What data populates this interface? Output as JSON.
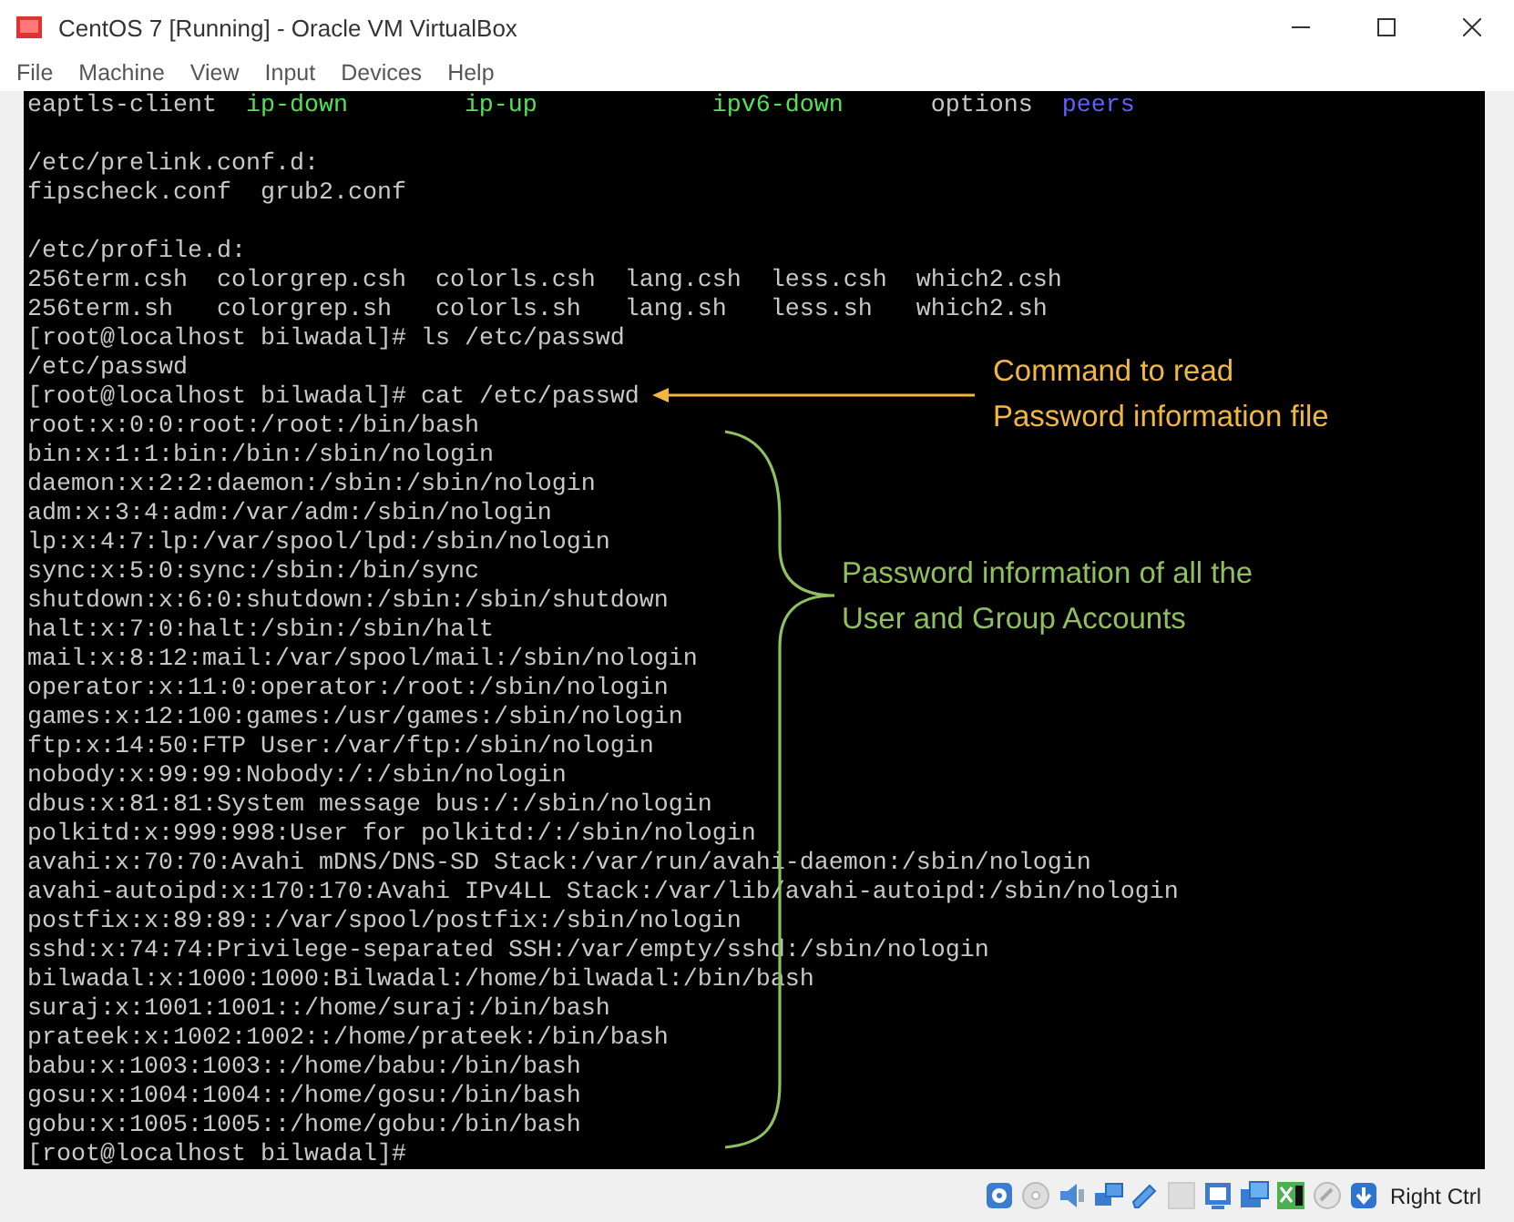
{
  "window": {
    "title": "CentOS 7 [Running] - Oracle VM VirtualBox"
  },
  "menu": [
    "File",
    "Machine",
    "View",
    "Input",
    "Devices",
    "Help"
  ],
  "terminal": {
    "lines": [
      {
        "kind": "columns",
        "segments": [
          {
            "text": "eaptls-client",
            "kind": "file"
          },
          {
            "text": "ip-down",
            "kind": "exec"
          },
          {
            "text": "ip-up",
            "kind": "exec"
          },
          {
            "text": "ipv6-down",
            "kind": "exec"
          },
          {
            "text": "options",
            "kind": "file"
          },
          {
            "text": "peers",
            "kind": "dir"
          }
        ]
      },
      {
        "kind": "blank"
      },
      {
        "kind": "text",
        "text": "/etc/prelink.conf.d:"
      },
      {
        "kind": "text",
        "text": "fipscheck.conf  grub2.conf"
      },
      {
        "kind": "blank"
      },
      {
        "kind": "text",
        "text": "/etc/profile.d:"
      },
      {
        "kind": "text",
        "text": "256term.csh  colorgrep.csh  colorls.csh  lang.csh  less.csh  which2.csh"
      },
      {
        "kind": "text",
        "text": "256term.sh   colorgrep.sh   colorls.sh   lang.sh   less.sh   which2.sh"
      },
      {
        "kind": "text",
        "text": "[root@localhost bilwadal]# ls /etc/passwd"
      },
      {
        "kind": "text",
        "text": "/etc/passwd"
      },
      {
        "kind": "text",
        "text": "[root@localhost bilwadal]# cat /etc/passwd"
      },
      {
        "kind": "text",
        "text": "root:x:0:0:root:/root:/bin/bash"
      },
      {
        "kind": "text",
        "text": "bin:x:1:1:bin:/bin:/sbin/nologin"
      },
      {
        "kind": "text",
        "text": "daemon:x:2:2:daemon:/sbin:/sbin/nologin"
      },
      {
        "kind": "text",
        "text": "adm:x:3:4:adm:/var/adm:/sbin/nologin"
      },
      {
        "kind": "text",
        "text": "lp:x:4:7:lp:/var/spool/lpd:/sbin/nologin"
      },
      {
        "kind": "text",
        "text": "sync:x:5:0:sync:/sbin:/bin/sync"
      },
      {
        "kind": "text",
        "text": "shutdown:x:6:0:shutdown:/sbin:/sbin/shutdown"
      },
      {
        "kind": "text",
        "text": "halt:x:7:0:halt:/sbin:/sbin/halt"
      },
      {
        "kind": "text",
        "text": "mail:x:8:12:mail:/var/spool/mail:/sbin/nologin"
      },
      {
        "kind": "text",
        "text": "operator:x:11:0:operator:/root:/sbin/nologin"
      },
      {
        "kind": "text",
        "text": "games:x:12:100:games:/usr/games:/sbin/nologin"
      },
      {
        "kind": "text",
        "text": "ftp:x:14:50:FTP User:/var/ftp:/sbin/nologin"
      },
      {
        "kind": "text",
        "text": "nobody:x:99:99:Nobody:/:/sbin/nologin"
      },
      {
        "kind": "text",
        "text": "dbus:x:81:81:System message bus:/:/sbin/nologin"
      },
      {
        "kind": "text",
        "text": "polkitd:x:999:998:User for polkitd:/:/sbin/nologin"
      },
      {
        "kind": "text",
        "text": "avahi:x:70:70:Avahi mDNS/DNS-SD Stack:/var/run/avahi-daemon:/sbin/nologin"
      },
      {
        "kind": "text",
        "text": "avahi-autoipd:x:170:170:Avahi IPv4LL Stack:/var/lib/avahi-autoipd:/sbin/nologin"
      },
      {
        "kind": "text",
        "text": "postfix:x:89:89::/var/spool/postfix:/sbin/nologin"
      },
      {
        "kind": "text",
        "text": "sshd:x:74:74:Privilege-separated SSH:/var/empty/sshd:/sbin/nologin"
      },
      {
        "kind": "text",
        "text": "bilwadal:x:1000:1000:Bilwadal:/home/bilwadal:/bin/bash"
      },
      {
        "kind": "text",
        "text": "suraj:x:1001:1001::/home/suraj:/bin/bash"
      },
      {
        "kind": "text",
        "text": "prateek:x:1002:1002::/home/prateek:/bin/bash"
      },
      {
        "kind": "text",
        "text": "babu:x:1003:1003::/home/babu:/bin/bash"
      },
      {
        "kind": "text",
        "text": "gosu:x:1004:1004::/home/gosu:/bin/bash"
      },
      {
        "kind": "text",
        "text": "gobu:x:1005:1005::/home/gobu:/bin/bash"
      },
      {
        "kind": "text",
        "text": "[root@localhost bilwadal]#"
      }
    ]
  },
  "annotations": [
    {
      "kind": "arrow",
      "color": "#f0b840",
      "lines": [
        "Command to read",
        "Password information file"
      ]
    },
    {
      "kind": "brace",
      "color": "#8fbf5f",
      "lines": [
        "Password information of all the",
        "User and Group Accounts"
      ]
    }
  ],
  "status_bar": {
    "host_key": "Right Ctrl"
  }
}
